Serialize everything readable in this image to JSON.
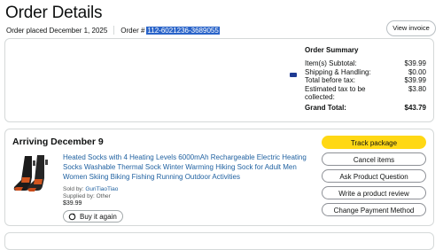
{
  "page": {
    "title": "Order Details",
    "order_placed": "Order placed December 1, 2025",
    "order_id_label": "Order #",
    "order_id": "112-6021236-3689055",
    "view_invoice": "View invoice"
  },
  "payment": {
    "icon": "card-icon"
  },
  "summary": {
    "title": "Order Summary",
    "rows": [
      {
        "label": "Item(s) Subtotal:",
        "value": "$39.99"
      },
      {
        "label": "Shipping & Handling:",
        "value": "$0.00"
      },
      {
        "label": "Total before tax:",
        "value": "$39.99"
      },
      {
        "label": "Estimated tax to be collected:",
        "value": "$3.80"
      }
    ],
    "grand_label": "Grand Total:",
    "grand_value": "$43.79"
  },
  "shipment": {
    "arriving": "Arriving December 9",
    "product_title": "Heated Socks with 4 Heating Levels 6000mAh Rechargeable Electric Heating Socks Washable Thermal Sock Winter Warming Hiking Sock for Adult Men Women Skiing Biking Fishing Running Outdoor Activities",
    "sold_by_label": "Sold by:",
    "sold_by": "GuriTiaoTiao",
    "supplied_by": "Supplied by: Other",
    "price": "$39.99",
    "buy_again": "Buy it again",
    "actions": [
      "Track package",
      "Cancel items",
      "Ask Product Question",
      "Write a product review",
      "Change Payment Method"
    ]
  }
}
